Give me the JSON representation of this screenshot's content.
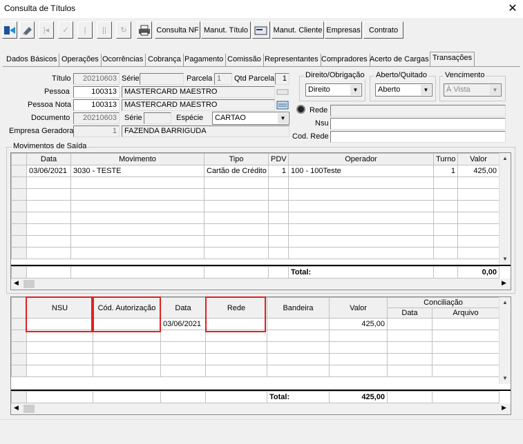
{
  "window": {
    "title": "Consulta de Títulos",
    "close": "✕"
  },
  "toolbar": {
    "consulta_nf": "Consulta NF",
    "manut_titulo": "Manut. Título",
    "manut_cliente": "Manut. Cliente",
    "empresas": "Empresas",
    "contrato": "Contrato"
  },
  "tabs": [
    "Dados Básicos",
    "Operações",
    "Ocorrências",
    "Cobrança",
    "Pagamento",
    "Comissão",
    "Representantes",
    "Compradores",
    "Acerto de Cargas",
    "Transações"
  ],
  "form": {
    "titulo_label": "Título",
    "titulo": "20210603",
    "serie_label": "Série",
    "serie": "",
    "parcela_label": "Parcela",
    "parcela": "1",
    "qtd_parcela_label": "Qtd Parcela",
    "qtd_parcela": "1",
    "pessoa_label": "Pessoa",
    "pessoa_cod": "100313",
    "pessoa_nome": "MASTERCARD MAESTRO",
    "pessoa_nota_label": "Pessoa Nota",
    "pessoa_nota_cod": "100313",
    "pessoa_nota_nome": "MASTERCARD MAESTRO",
    "documento_label": "Documento",
    "documento": "20210603",
    "serie2_label": "Série",
    "serie2": "",
    "especie_label": "Espécie",
    "especie": "CARTAO",
    "empresa_label": "Empresa Geradora",
    "empresa_cod": "1",
    "empresa_nome": "FAZENDA BARRIGUDA",
    "direito_label": "Direito/Obrigação",
    "direito": "Direito",
    "aberto_label": "Aberto/Quitado",
    "aberto": "Aberto",
    "vencimento_label": "Vencimento",
    "vencimento": "À Vista",
    "rede_label": "Rede",
    "rede": "",
    "nsu_label": "Nsu",
    "nsu": "",
    "cod_rede_label": "Cod. Rede",
    "cod_rede": ""
  },
  "movimentos": {
    "group_label": "Movimentos de Saída",
    "headers": [
      "Data",
      "Movimento",
      "Tipo",
      "PDV",
      "Operador",
      "Turno",
      "Valor"
    ],
    "rows": [
      [
        "03/06/2021",
        "3030 - TESTE",
        "Cartão de Crédito",
        "1",
        "100 - 100Teste",
        "1",
        "425,00"
      ]
    ],
    "total_label": "Total:",
    "total": "0,00"
  },
  "transacoes": {
    "headers": [
      "NSU",
      "Cód. Autorização",
      "Data",
      "Rede",
      "Bandeira",
      "Valor"
    ],
    "conciliacao": "Conciliação",
    "conc_sub": [
      "Data",
      "Arquivo"
    ],
    "rows": [
      [
        "",
        "",
        "03/06/2021",
        "",
        "",
        "425,00",
        "",
        ""
      ]
    ],
    "total_label": "Total:",
    "total": "425,00"
  },
  "colors": {
    "highlight": "#e02020"
  }
}
